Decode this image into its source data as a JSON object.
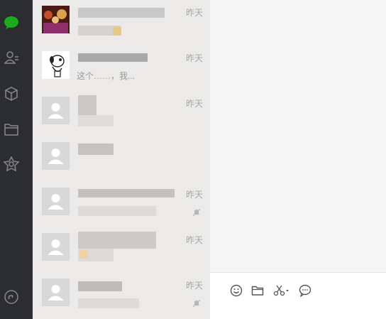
{
  "sidebar": {
    "icons": [
      "chat-icon",
      "contacts-icon",
      "box-icon",
      "folder-icon",
      "favorites-icon",
      "miniprogram-icon"
    ],
    "accent": "#1aad19"
  },
  "chats": [
    {
      "time": "昨天",
      "preview": ""
    },
    {
      "time": "昨天",
      "preview": "这个……，我..."
    },
    {
      "time": "昨天",
      "preview": ""
    },
    {
      "time": "",
      "preview": ""
    },
    {
      "time": "昨天",
      "preview": ""
    },
    {
      "time": "昨天",
      "preview": ""
    },
    {
      "time": "昨天",
      "preview": ""
    }
  ],
  "toolbar": {
    "icons": [
      "emoji-icon",
      "folder-icon",
      "scissors-icon",
      "chat-history-icon"
    ]
  }
}
